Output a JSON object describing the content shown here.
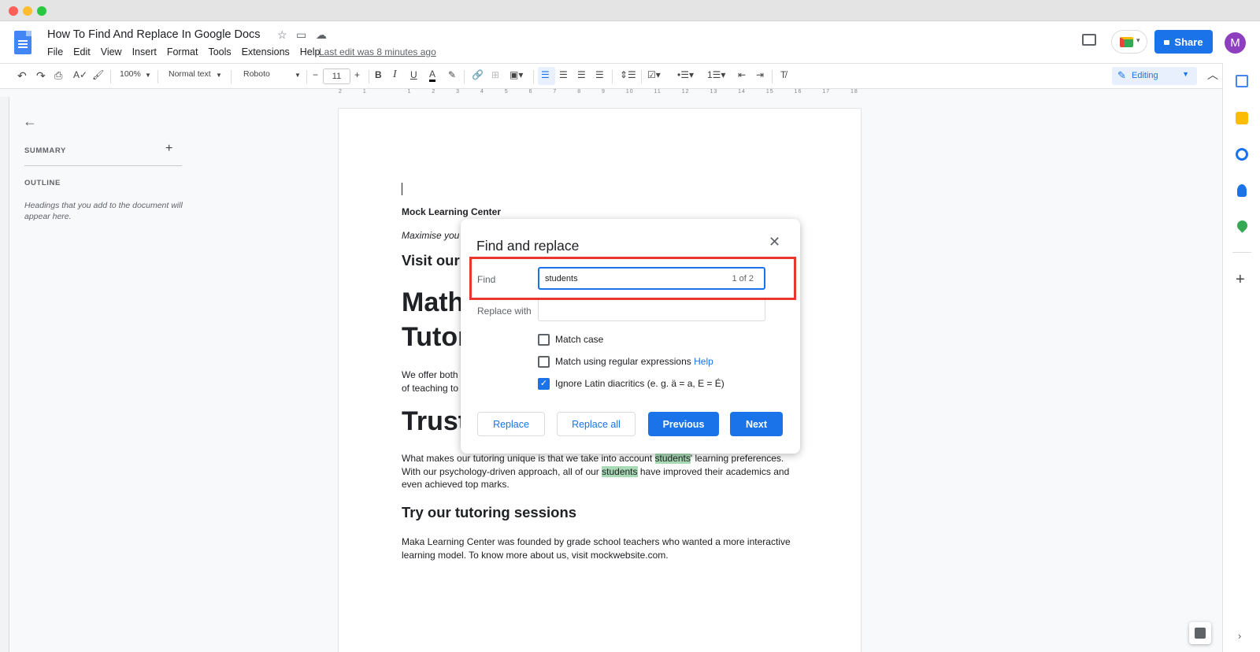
{
  "doc": {
    "title": "How To Find And Replace In Google Docs",
    "last_edit": "Last edit was 8 minutes ago",
    "menu": [
      "File",
      "Edit",
      "View",
      "Insert",
      "Format",
      "Tools",
      "Extensions",
      "Help"
    ],
    "share_label": "Share",
    "avatar_initial": "M"
  },
  "toolbar": {
    "zoom": "100%",
    "style": "Normal text",
    "font": "Roboto",
    "font_size": "11",
    "mode": "Editing"
  },
  "ruler": [
    "2",
    "1",
    "",
    "1",
    "2",
    "3",
    "4",
    "5",
    "6",
    "7",
    "8",
    "9",
    "10",
    "11",
    "12",
    "13",
    "14",
    "15",
    "16",
    "17",
    "18"
  ],
  "side_panel": {
    "summary_label": "SUMMARY",
    "outline_label": "OUTLINE",
    "outline_hint": "Headings that you add to the document will appear here."
  },
  "page": {
    "org": "Mock Learning Center",
    "tagline": "Maximise you",
    "visit": "Visit our",
    "math_line1": "Math",
    "math_line2": "Tutor",
    "offer_line1": "We offer both",
    "offer_line2": "of teaching to",
    "trust": "Trust",
    "body2_a": "What makes our tutoring unique is that we take into account ",
    "body2_hl1": "students",
    "body2_b": "' learning preferences. With our psychology-driven approach, all of our ",
    "body2_hl2": "students",
    "body2_c": " have improved their academics and even achieved top marks.",
    "try_heading": "Try our tutoring sessions",
    "body3": "Maka Learning Center was founded by grade school teachers who wanted a more interactive learning model. To know more about us, visit mockwebsite.com."
  },
  "dialog": {
    "title": "Find and replace",
    "find_label": "Find",
    "find_value": "students",
    "match_count": "1 of 2",
    "replace_label": "Replace with",
    "replace_value": "",
    "match_case_label": "Match case",
    "regex_label": "Match using regular expressions",
    "regex_help": "Help",
    "diacritics_label": "Ignore Latin diacritics (e. g. ä = a, E = É)",
    "match_case_checked": false,
    "regex_checked": false,
    "diacritics_checked": true,
    "replace_btn": "Replace",
    "replace_all_btn": "Replace all",
    "previous_btn": "Previous",
    "next_btn": "Next"
  },
  "colors": {
    "accent": "#1a73e8",
    "highlight": "#a8dab5",
    "annotation_box": "#e8372e"
  }
}
